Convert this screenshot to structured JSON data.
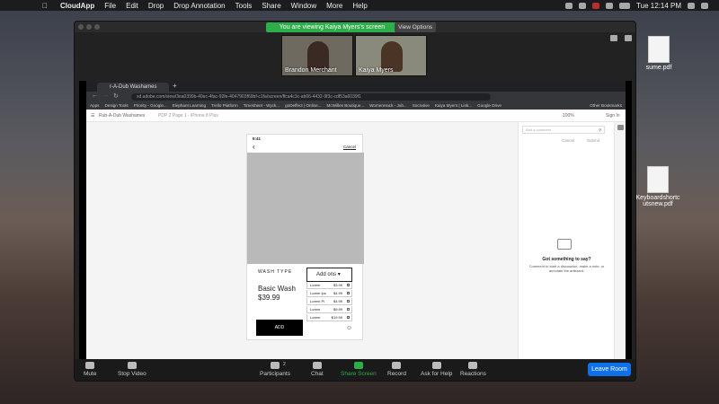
{
  "menubar": {
    "app": "CloudApp",
    "items": [
      "File",
      "Edit",
      "Drop",
      "Drop Annotation",
      "Tools",
      "Share",
      "Window",
      "More",
      "Help"
    ],
    "clock": "Tue 12:14 PM"
  },
  "zoom": {
    "banner": "You are viewing Kaiya Myers's screen",
    "view_options": "View Options",
    "participants_videos": [
      {
        "name": "Brandon Merchant"
      },
      {
        "name": "Kaiya Myers"
      }
    ],
    "controls": [
      {
        "label": "Mute",
        "icon": "microphone-icon"
      },
      {
        "label": "Stop Video",
        "icon": "video-camera-icon"
      },
      {
        "label": "Participants",
        "icon": "participants-icon",
        "count": "2"
      },
      {
        "label": "Chat",
        "icon": "chat-icon"
      },
      {
        "label": "Share Screen",
        "icon": "share-screen-icon"
      },
      {
        "label": "Record",
        "icon": "record-icon"
      },
      {
        "label": "Ask for Help",
        "icon": "help-icon"
      },
      {
        "label": "Reactions",
        "icon": "reactions-icon"
      }
    ],
    "leave": "Leave Room"
  },
  "browser": {
    "tab_title": "r-A-Dub Washames",
    "url": "xd.adobe.com/view/3ea0399b-40ec-4fac-92fe-4047903f69bf-c1fa/screen/ffca4c3c-ab06-4432-9f3c-cdf53a6039f1",
    "bookmarks": [
      "Apps",
      "Design Tools",
      "Priority - Google...",
      "Elephant Learning",
      "Trello Platform",
      "Timesheet - Wyck...",
      "goDeffect | Online...",
      "McWilles Boutique...",
      "WomenHack - Job...",
      "Socrative",
      "Kaiya Myers | Link...",
      "Google Drive",
      "Other Bookmarks"
    ]
  },
  "xd": {
    "header_left": "Rub-A-Dub Washames",
    "breadcrumb": "PDP 2 Page 1 - iPhone 8 Plus",
    "zoom_level": "100%",
    "sign_in": "Sign In",
    "comment_placeholder": "Add a comment",
    "cancel": "Cancel",
    "submit": "Submit",
    "empty_title": "Got something to say?",
    "empty_body": "Comment to start a discussion, make a note, or annotate the artboard."
  },
  "phone": {
    "time": "9:41",
    "cancel": "Cancel",
    "wash_type": "WASH TYPE",
    "product": "Basic Wash",
    "price": "$39.99",
    "addons_label": "Add ons",
    "addons": [
      {
        "name": "Lorem",
        "price": "$3.99"
      },
      {
        "name": "Lorem Ips",
        "price": "$4.99"
      },
      {
        "name": "Lorem Pi",
        "price": "$4.99"
      },
      {
        "name": "Lorem",
        "price": "$9.99"
      },
      {
        "name": "Lorem",
        "price": "$19.99"
      }
    ],
    "add_button": "ADD"
  },
  "desktop_files": [
    {
      "name": "sume.pdf"
    },
    {
      "name": "Keyboardshortc utsnew.pdf"
    }
  ],
  "colors": {
    "zoom_green": "#2dae4a",
    "leave_blue": "#0e71eb"
  }
}
